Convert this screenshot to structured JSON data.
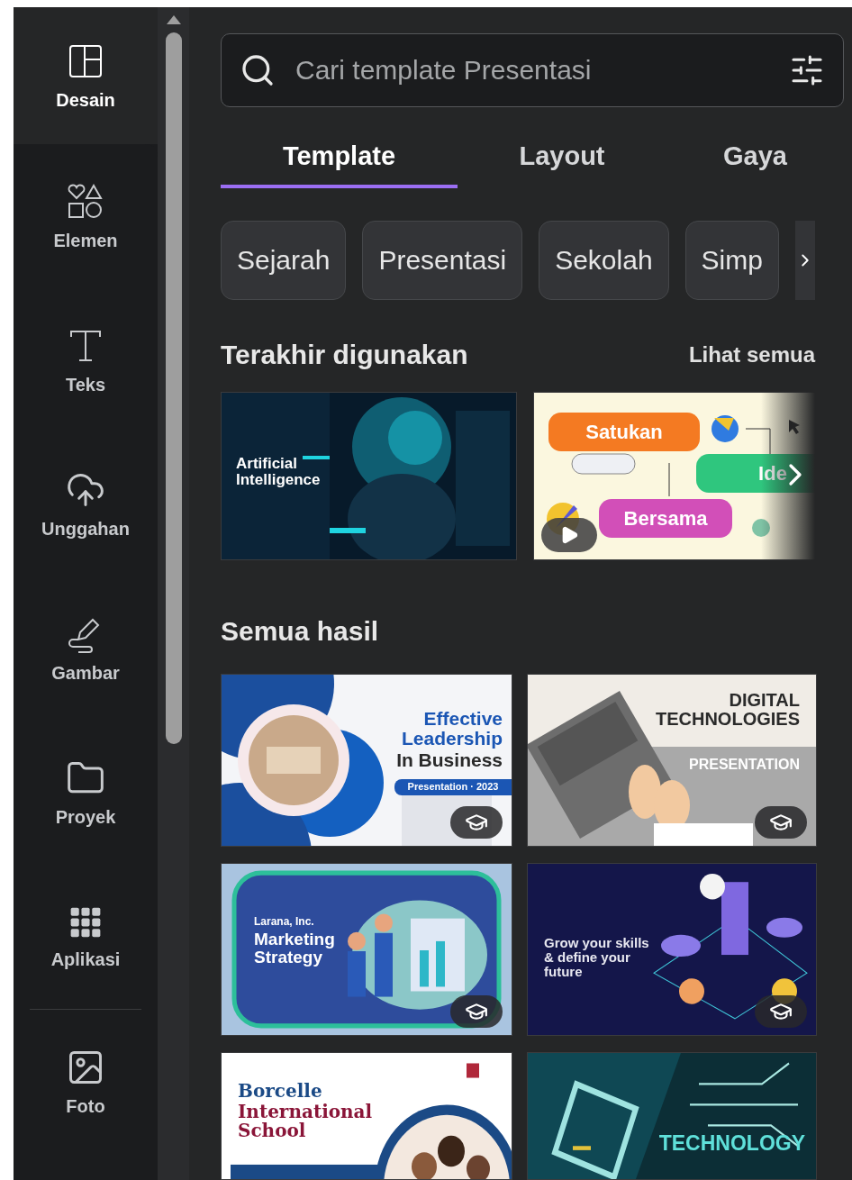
{
  "sidebar": {
    "items": [
      {
        "label": "Desain",
        "selected": true
      },
      {
        "label": "Elemen",
        "selected": false
      },
      {
        "label": "Teks",
        "selected": false
      },
      {
        "label": "Unggahan",
        "selected": false
      },
      {
        "label": "Gambar",
        "selected": false
      },
      {
        "label": "Proyek",
        "selected": false
      },
      {
        "label": "Aplikasi",
        "selected": false
      },
      {
        "label": "Foto",
        "selected": false
      }
    ]
  },
  "search": {
    "placeholder": "Cari template Presentasi"
  },
  "tabs": [
    {
      "label": "Template",
      "selected": true
    },
    {
      "label": "Layout",
      "selected": false
    },
    {
      "label": "Gaya",
      "selected": false
    }
  ],
  "chips": [
    "Sejarah",
    "Presentasi",
    "Sekolah",
    "Simp"
  ],
  "recent": {
    "title": "Terakhir digunakan",
    "link": "Lihat semua",
    "items": [
      {
        "kind": "ai",
        "video": false,
        "texts": [
          "Artificial Intelligence"
        ]
      },
      {
        "kind": "mindmap",
        "video": true,
        "texts": [
          "Satukan",
          "Ide",
          "Bersama"
        ]
      }
    ]
  },
  "results": {
    "title": "Semua hasil",
    "items": [
      {
        "kind": "leadership",
        "premium": true,
        "texts": [
          "Effective Leadership",
          "In Business",
          "Presentation · 2023"
        ]
      },
      {
        "kind": "digital",
        "premium": true,
        "texts": [
          "DIGITAL TECHNOLOGIES",
          "PRESENTATION"
        ]
      },
      {
        "kind": "marketing",
        "premium": true,
        "texts": [
          "Larana, Inc.",
          "Marketing Strategy"
        ]
      },
      {
        "kind": "grow",
        "premium": true,
        "texts": [
          "Grow your skills & define your future"
        ]
      },
      {
        "kind": "school",
        "premium": false,
        "texts": [
          "Borcelle",
          "International School"
        ]
      },
      {
        "kind": "tech",
        "premium": false,
        "texts": [
          "TECHNOLOGY"
        ]
      }
    ]
  }
}
